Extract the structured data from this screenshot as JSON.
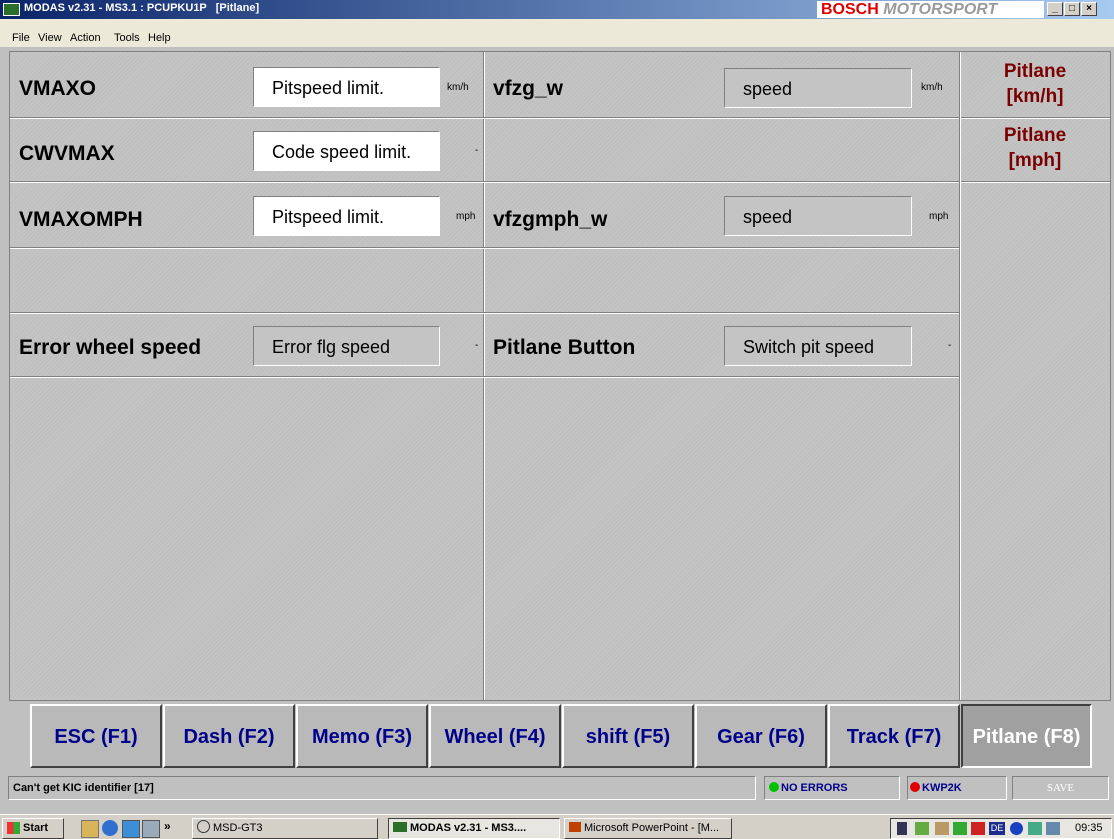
{
  "window": {
    "title": "MODAS v2.31 - MS3.1 : PCUPKU1P   [Pitlane]",
    "brand_primary": "BOSCH",
    "brand_secondary": "MOTORSPORT",
    "buttons": [
      "_",
      "□",
      "×"
    ]
  },
  "menu": [
    "File",
    "View",
    "Action",
    "Tools",
    "Help"
  ],
  "rows": [
    {
      "left_label": "VMAXO",
      "left_field": "Pitspeed limit.",
      "left_unit": "km/h",
      "right_label": "vfzg_w",
      "right_field": "speed",
      "right_unit": "km/h"
    },
    {
      "left_label": "CWVMAX",
      "left_field": "Code speed limit.",
      "left_unit": "-"
    },
    {
      "left_label": "VMAXOMPH",
      "left_field": "Pitspeed limit.",
      "left_unit": "mph",
      "right_label": "vfzgmph_w",
      "right_field": "speed",
      "right_unit": "mph"
    },
    {},
    {
      "left_label": "Error wheel speed",
      "left_field": "Error flg speed",
      "left_unit": "-",
      "right_label": "Pitlane Button",
      "right_field": "Switch pit speed",
      "right_unit": "-"
    }
  ],
  "side_buttons": [
    {
      "line1": "Pitlane",
      "line2": "[km/h]"
    },
    {
      "line1": "Pitlane",
      "line2": "[mph]"
    }
  ],
  "fkeys": [
    "ESC (F1)",
    "Dash (F2)",
    "Memo (F3)",
    "Wheel  (F4)",
    "shift  (F5)",
    "Gear  (F6)",
    "Track  (F7)",
    "Pitlane (F8)"
  ],
  "fkeys_active_index": 7,
  "status": {
    "message": "Can't get KIC identifier [17]",
    "errors": "NO ERRORS",
    "errors_color": "#00c000",
    "protocol": "KWP2K",
    "protocol_color": "#e00000",
    "save": "SAVE"
  },
  "taskbar": {
    "start": "Start",
    "quick_more": "»",
    "items": [
      "MSD-GT3",
      "MODAS v2.31 - MS3....",
      "Microsoft PowerPoint - [M..."
    ],
    "tray_lang": "DE",
    "clock": "09:35"
  }
}
